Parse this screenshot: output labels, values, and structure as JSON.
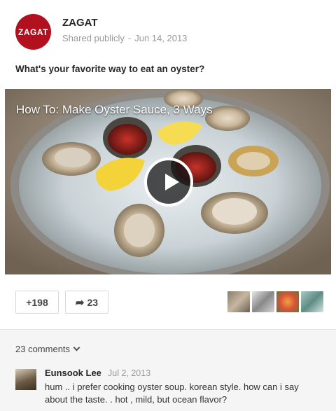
{
  "post": {
    "logo_text": "ZAGAT",
    "author": "ZAGAT",
    "visibility": "Shared publicly",
    "separator": "-",
    "date": "Jun 14, 2013",
    "text": "What's your favorite way to eat an oyster?"
  },
  "video": {
    "title": "How To: Make Oyster Sauce, 3 Ways"
  },
  "actions": {
    "plus_label": "+198",
    "share_count": "23",
    "share_icon": "share-arrow-icon"
  },
  "comments": {
    "toggle_label": "23 comments",
    "items": [
      {
        "author": "Eunsook Lee",
        "date": "Jul 2, 2013",
        "text": "hum .. i prefer cooking oyster soup. korean style. how can i say about the taste. . hot , mild, but ocean flavor?"
      }
    ]
  },
  "colors": {
    "brand": "#b1101f",
    "comments_bg": "#f5f5f5"
  }
}
